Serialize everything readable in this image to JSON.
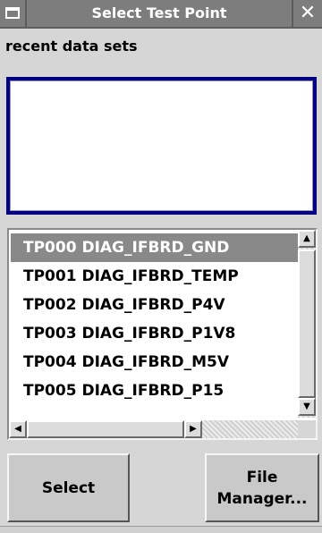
{
  "window": {
    "title": "Select Test Point",
    "close_glyph": "✕"
  },
  "recent": {
    "label": "recent data sets"
  },
  "test_points": {
    "items": [
      "TP000 DIAG_IFBRD_GND",
      "TP001 DIAG_IFBRD_TEMP",
      "TP002 DIAG_IFBRD_P4V",
      "TP003 DIAG_IFBRD_P1V8",
      "TP004 DIAG_IFBRD_M5V",
      "TP005 DIAG_IFBRD_P15"
    ],
    "selected_index": 0
  },
  "buttons": {
    "select_label": "Select",
    "file_manager_line1": "File",
    "file_manager_line2": "Manager..."
  },
  "icons": {
    "scroll_up": "▲",
    "scroll_down": "▼",
    "scroll_left": "◀",
    "scroll_right": "▶"
  },
  "colors": {
    "titlebar": "#7d7d7d",
    "selection": "#898989",
    "focus_border": "#000080"
  }
}
